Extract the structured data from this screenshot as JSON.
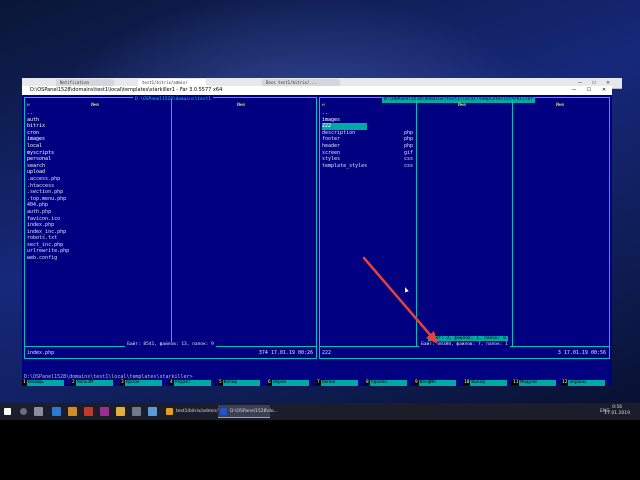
{
  "browser": {
    "tabs": [
      "Notification",
      "test1/bitrix/admin/",
      "Docs test1/bitrix/..."
    ],
    "controls": {
      "minimize": "—",
      "maximize": "☐",
      "close": "✕"
    }
  },
  "window": {
    "title": "D:\\OSPanel1528\\domains\\test1\\local\\templates\\starkiller1 - Far 3.0.5577 x64",
    "controls": {
      "minimize": "—",
      "maximize": "☐",
      "close": "✕"
    }
  },
  "left_panel": {
    "path": "D:\\OSPanel1528\\domains\\test1",
    "col_n": "н",
    "col_name1": "Имя",
    "col_name2": "Имя",
    "files": [
      {
        "name": "..",
        "dir": true
      },
      {
        "name": "auth",
        "dir": true
      },
      {
        "name": "bitrix",
        "dir": true
      },
      {
        "name": "cron",
        "dir": true
      },
      {
        "name": "images",
        "dir": true
      },
      {
        "name": "local",
        "dir": true
      },
      {
        "name": "myscripts",
        "dir": true
      },
      {
        "name": "personal",
        "dir": true
      },
      {
        "name": "search",
        "dir": true
      },
      {
        "name": "upload",
        "dir": true
      },
      {
        "name": ".access.php",
        "dir": false
      },
      {
        "name": ".htaccess",
        "dir": false
      },
      {
        "name": ".section.php",
        "dir": false
      },
      {
        "name": ".top.menu.php",
        "dir": false
      },
      {
        "name": "404.php",
        "dir": false
      },
      {
        "name": "auth.php",
        "dir": false
      },
      {
        "name": "favicon.ico",
        "dir": false
      },
      {
        "name": "index.php",
        "dir": false
      },
      {
        "name": "index_inc.php",
        "dir": false
      },
      {
        "name": "robots.txt",
        "dir": false
      },
      {
        "name": "sect_inc.php",
        "dir": false
      },
      {
        "name": "urlrewrite.php",
        "dir": false
      },
      {
        "name": "web.config",
        "dir": false
      }
    ],
    "info": "Байт: 8541, файлов: 13, папок: 9",
    "current_file": "index.php",
    "current_meta": "374 17.01.19 00:26"
  },
  "right_panel": {
    "path": "D:\\OSPanel1528\\domains\\test1\\local\\templates\\starkiller",
    "col_n": "н",
    "col_name1": "Имя",
    "col_name2": "Имя",
    "files": [
      {
        "name": "..",
        "ext": "",
        "dir": true
      },
      {
        "name": "images",
        "ext": "",
        "dir": true
      },
      {
        "name": "222",
        "ext": "",
        "dir": true,
        "selected": true
      },
      {
        "name": "description",
        "ext": "php",
        "dir": false
      },
      {
        "name": "footer",
        "ext": "php",
        "dir": false
      },
      {
        "name": "header",
        "ext": "php",
        "dir": false
      },
      {
        "name": "screen",
        "ext": "gif",
        "dir": false
      },
      {
        "name": "styles",
        "ext": "css",
        "dir": false
      },
      {
        "name": "template_styles",
        "ext": "css",
        "dir": false
      }
    ],
    "info": "Байт: 38388, файлов: 7, папок: 1",
    "selection_info": "Байт: 3, файлов: 1, папок: 0",
    "current_file": "222",
    "current_meta": "3 17.01.19 00:56"
  },
  "command_line": "D:\\OSPanel1528\\domains\\test1\\local\\templates\\starkiller>",
  "keybar": [
    {
      "n": "1",
      "label": "Помощь"
    },
    {
      "n": "2",
      "label": "ПользМ"
    },
    {
      "n": "3",
      "label": "Просм"
    },
    {
      "n": "4",
      "label": "Редакт"
    },
    {
      "n": "5",
      "label": "Копир"
    },
    {
      "n": "6",
      "label": "Перен"
    },
    {
      "n": "7",
      "label": "Папка"
    },
    {
      "n": "8",
      "label": "Удален"
    },
    {
      "n": "9",
      "label": "КонфМн"
    },
    {
      "n": "10",
      "label": "Выход"
    },
    {
      "n": "11",
      "label": "Модули"
    },
    {
      "n": "12",
      "label": "Экраны"
    }
  ],
  "taskbar": {
    "apps": [
      {
        "label": "test1/bitrix/admin/...",
        "color": "#e0a020"
      },
      {
        "label": "D:\\OSPanel1528\\do...",
        "color": "#2255cc"
      }
    ],
    "tray_lang": "ENG",
    "time": "0:56",
    "date": "17.01.2019"
  },
  "colors": {
    "far_background": "#000080",
    "panel_border": "#00bfbf",
    "selection": "#00a8a8",
    "arrow": "#e8413a"
  }
}
